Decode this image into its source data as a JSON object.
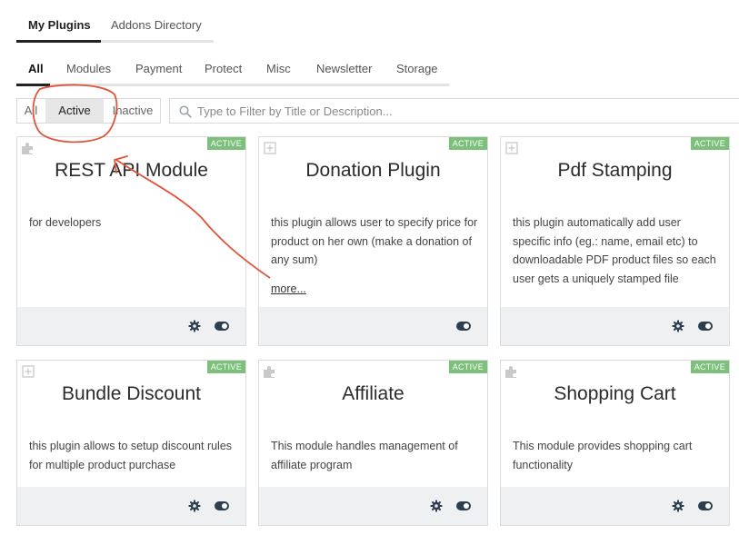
{
  "top_tabs": [
    {
      "label": "My Plugins",
      "active": true
    },
    {
      "label": "Addons Directory",
      "active": false
    }
  ],
  "category_tabs": [
    {
      "label": "All",
      "active": true
    },
    {
      "label": "Modules"
    },
    {
      "label": "Payment"
    },
    {
      "label": "Protect"
    },
    {
      "label": "Misc"
    },
    {
      "label": "Newsletter"
    },
    {
      "label": "Storage"
    }
  ],
  "status_filter": {
    "options": [
      "All",
      "Active",
      "Inactive"
    ],
    "selected": "Active"
  },
  "search": {
    "placeholder": "Type to Filter by Title or Description...",
    "value": ""
  },
  "plugins": [
    {
      "title": "REST API Module",
      "description": "for developers",
      "status": "ACTIVE",
      "icon": "puzzle-icon",
      "has_settings": true,
      "more": ""
    },
    {
      "title": "Donation Plugin",
      "description": "this plugin allows user to specify price for product on her own (make a donation of any sum)",
      "status": "ACTIVE",
      "icon": "plus-square-icon",
      "has_settings": false,
      "more": "more..."
    },
    {
      "title": "Pdf Stamping",
      "description": "this plugin automatically add user specific info (eg.: name, email etc) to downloadable PDF product files so each user gets a uniquely stamped file",
      "status": "ACTIVE",
      "icon": "plus-square-icon",
      "has_settings": true,
      "more": ""
    },
    {
      "title": "Bundle Discount",
      "description": "this plugin allows to setup discount rules for multiple product purchase",
      "status": "ACTIVE",
      "icon": "plus-square-icon",
      "has_settings": true,
      "more": ""
    },
    {
      "title": "Affiliate",
      "description": "This module handles management of affiliate program",
      "status": "ACTIVE",
      "icon": "puzzle-icon",
      "has_settings": true,
      "more": ""
    },
    {
      "title": "Shopping Cart",
      "description": "This module provides shopping cart functionality",
      "status": "ACTIVE",
      "icon": "puzzle-icon",
      "has_settings": true,
      "more": ""
    }
  ],
  "colors": {
    "badge": "#7cc07c",
    "annotation": "#e0543c",
    "footer": "#eef0f2",
    "toggle": "#2c3e50"
  }
}
